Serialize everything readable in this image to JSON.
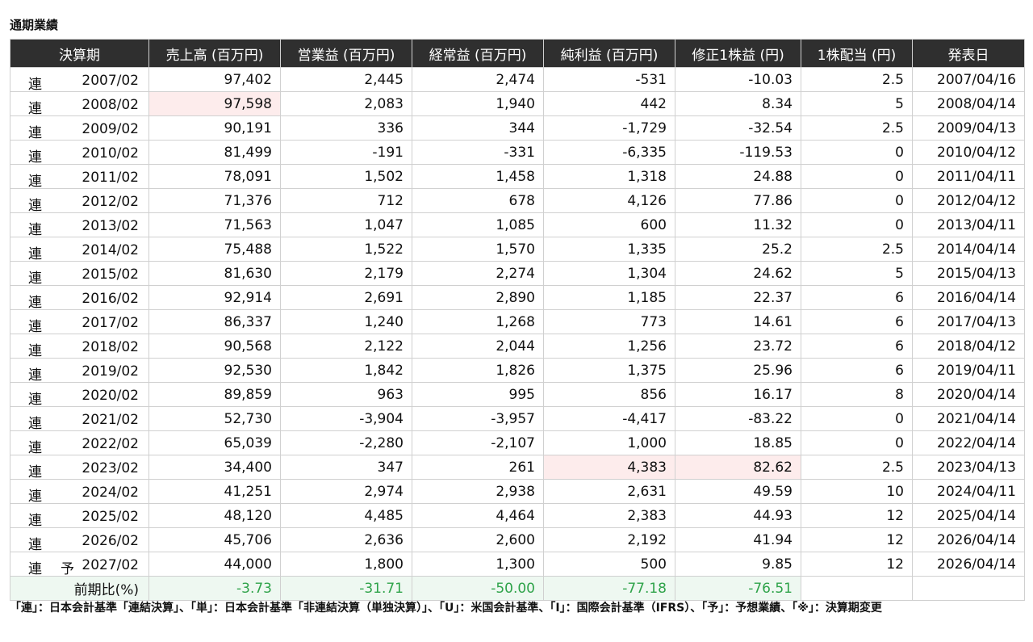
{
  "title": "通期業績",
  "headers": [
    "決算期",
    "売上高 (百万円)",
    "営業益 (百万円)",
    "経常益 (百万円)",
    "純利益 (百万円)",
    "修正1株益 (円)",
    "1株配当 (円)",
    "発表日"
  ],
  "rows": [
    {
      "kind": "連",
      "flag": "",
      "period": "2007/02",
      "sales": "97,402",
      "op": "2,445",
      "ord": "2,474",
      "net": "-531",
      "eps": "-10.03",
      "div": "2.5",
      "date": "2007/04/16"
    },
    {
      "kind": "連",
      "flag": "",
      "period": "2008/02",
      "sales": "97,598",
      "op": "2,083",
      "ord": "1,940",
      "net": "442",
      "eps": "8.34",
      "div": "5",
      "date": "2008/04/14"
    },
    {
      "kind": "連",
      "flag": "",
      "period": "2009/02",
      "sales": "90,191",
      "op": "336",
      "ord": "344",
      "net": "-1,729",
      "eps": "-32.54",
      "div": "2.5",
      "date": "2009/04/13"
    },
    {
      "kind": "連",
      "flag": "",
      "period": "2010/02",
      "sales": "81,499",
      "op": "-191",
      "ord": "-331",
      "net": "-6,335",
      "eps": "-119.53",
      "div": "0",
      "date": "2010/04/12"
    },
    {
      "kind": "連",
      "flag": "",
      "period": "2011/02",
      "sales": "78,091",
      "op": "1,502",
      "ord": "1,458",
      "net": "1,318",
      "eps": "24.88",
      "div": "0",
      "date": "2011/04/11"
    },
    {
      "kind": "連",
      "flag": "",
      "period": "2012/02",
      "sales": "71,376",
      "op": "712",
      "ord": "678",
      "net": "4,126",
      "eps": "77.86",
      "div": "0",
      "date": "2012/04/12"
    },
    {
      "kind": "連",
      "flag": "",
      "period": "2013/02",
      "sales": "71,563",
      "op": "1,047",
      "ord": "1,085",
      "net": "600",
      "eps": "11.32",
      "div": "0",
      "date": "2013/04/11"
    },
    {
      "kind": "連",
      "flag": "",
      "period": "2014/02",
      "sales": "75,488",
      "op": "1,522",
      "ord": "1,570",
      "net": "1,335",
      "eps": "25.2",
      "div": "2.5",
      "date": "2014/04/14"
    },
    {
      "kind": "連",
      "flag": "",
      "period": "2015/02",
      "sales": "81,630",
      "op": "2,179",
      "ord": "2,274",
      "net": "1,304",
      "eps": "24.62",
      "div": "5",
      "date": "2015/04/13"
    },
    {
      "kind": "連",
      "flag": "",
      "period": "2016/02",
      "sales": "92,914",
      "op": "2,691",
      "ord": "2,890",
      "net": "1,185",
      "eps": "22.37",
      "div": "6",
      "date": "2016/04/14"
    },
    {
      "kind": "連",
      "flag": "",
      "period": "2017/02",
      "sales": "86,337",
      "op": "1,240",
      "ord": "1,268",
      "net": "773",
      "eps": "14.61",
      "div": "6",
      "date": "2017/04/13"
    },
    {
      "kind": "連",
      "flag": "",
      "period": "2018/02",
      "sales": "90,568",
      "op": "2,122",
      "ord": "2,044",
      "net": "1,256",
      "eps": "23.72",
      "div": "6",
      "date": "2018/04/12"
    },
    {
      "kind": "連",
      "flag": "",
      "period": "2019/02",
      "sales": "92,530",
      "op": "1,842",
      "ord": "1,826",
      "net": "1,375",
      "eps": "25.96",
      "div": "6",
      "date": "2019/04/11"
    },
    {
      "kind": "連",
      "flag": "",
      "period": "2020/02",
      "sales": "89,859",
      "op": "963",
      "ord": "995",
      "net": "856",
      "eps": "16.17",
      "div": "8",
      "date": "2020/04/14"
    },
    {
      "kind": "連",
      "flag": "",
      "period": "2021/02",
      "sales": "52,730",
      "op": "-3,904",
      "ord": "-3,957",
      "net": "-4,417",
      "eps": "-83.22",
      "div": "0",
      "date": "2021/04/14"
    },
    {
      "kind": "連",
      "flag": "",
      "period": "2022/02",
      "sales": "65,039",
      "op": "-2,280",
      "ord": "-2,107",
      "net": "1,000",
      "eps": "18.85",
      "div": "0",
      "date": "2022/04/14"
    },
    {
      "kind": "連",
      "flag": "",
      "period": "2023/02",
      "sales": "34,400",
      "op": "347",
      "ord": "261",
      "net": "4,383",
      "eps": "82.62",
      "div": "2.5",
      "date": "2023/04/13"
    },
    {
      "kind": "連",
      "flag": "",
      "period": "2024/02",
      "sales": "41,251",
      "op": "2,974",
      "ord": "2,938",
      "net": "2,631",
      "eps": "49.59",
      "div": "10",
      "date": "2024/04/11"
    },
    {
      "kind": "連",
      "flag": "",
      "period": "2025/02",
      "sales": "48,120",
      "op": "4,485",
      "ord": "4,464",
      "net": "2,383",
      "eps": "44.93",
      "div": "12",
      "date": "2025/04/14"
    },
    {
      "kind": "連",
      "flag": "",
      "period": "2026/02",
      "sales": "45,706",
      "op": "2,636",
      "ord": "2,600",
      "net": "2,192",
      "eps": "41.94",
      "div": "12",
      "date": "2026/04/14"
    },
    {
      "kind": "連",
      "flag": "予",
      "period": "2027/02",
      "sales": "44,000",
      "op": "1,800",
      "ord": "1,300",
      "net": "500",
      "eps": "9.85",
      "div": "12",
      "date": "2026/04/14"
    }
  ],
  "yoy": {
    "label": "前期比(%)",
    "sales": "-3.73",
    "op": "-31.71",
    "ord": "-50.00",
    "net": "-77.18",
    "eps": "-76.51"
  },
  "note": "「連」：日本会計基準「連結決算」、「単」：日本会計基準「非連結決算（単独決算）」、「U」：米国会計基準、「I」：国際会計基準（IFRS）、「予」：予想業績、「※」：決算期変更",
  "colors": {
    "header_bg": "#2f2f2f",
    "highlight_bg": "#fdecec",
    "yoy_bg": "#eef8f1",
    "yoy_text": "#2fa34a"
  }
}
